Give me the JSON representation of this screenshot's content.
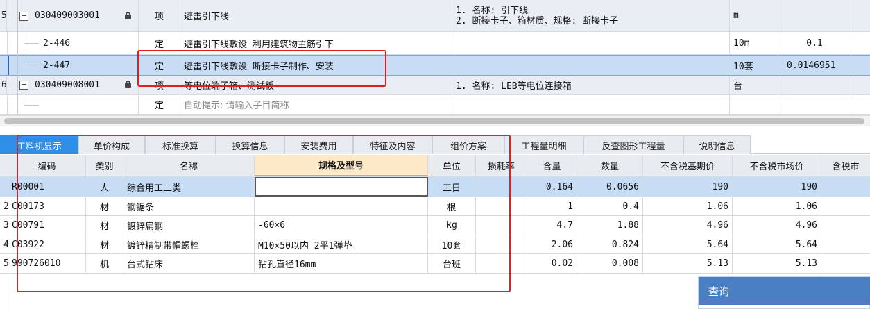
{
  "top_table": {
    "rows": [
      {
        "num": "5",
        "code": "030409003001",
        "lock": true,
        "type": "项",
        "name": "避雷引下线",
        "feature_lines": [
          "1. 名称: 引下线",
          "2. 断接卡子、箱材质、规格: 断接卡子"
        ],
        "unit": "m",
        "qty": "",
        "extra": ""
      },
      {
        "num": "",
        "code": "2-446",
        "lock": false,
        "type": "定",
        "name": "避雷引下线敷设 利用建筑物主筋引下",
        "feature_lines": [],
        "unit": "10m",
        "qty": "0.1",
        "extra": ""
      },
      {
        "num": "",
        "code": "2-447",
        "lock": false,
        "type": "定",
        "name": "避雷引下线敷设 断接卡子制作、安装",
        "feature_lines": [],
        "unit": "10套",
        "qty": "0.0146951",
        "extra": ""
      },
      {
        "num": "6",
        "code": "030409008001",
        "lock": true,
        "type": "项",
        "name": "等电位端子箱、测试板",
        "feature_lines": [
          "1. 名称: LEB等电位连接箱"
        ],
        "unit": "台",
        "qty": "",
        "extra": ""
      },
      {
        "num": "",
        "code": "",
        "lock": false,
        "type": "定",
        "name": "自动提示: 请输入子目简称",
        "feature_lines": [],
        "unit": "",
        "qty": "",
        "extra": ""
      }
    ]
  },
  "tabs": [
    "工料机显示",
    "单价构成",
    "标准换算",
    "换算信息",
    "安装费用",
    "特征及内容",
    "组价方案",
    "工程量明细",
    "反查图形工程量",
    "说明信息"
  ],
  "active_tab": "工料机显示",
  "bottom_table": {
    "headers": [
      "编码",
      "类别",
      "名称",
      "规格及型号",
      "单位",
      "损耗率",
      "含量",
      "数量",
      "不含税基期价",
      "不含税市场价",
      "含税市"
    ],
    "rows": [
      {
        "idx": "",
        "code": "R00001",
        "cat": "人",
        "name": "综合用工二类",
        "spec": "",
        "unit": "工日",
        "loss": "",
        "content": "0.164",
        "qty": "0.0656",
        "base": "190",
        "market": "190"
      },
      {
        "idx": "2",
        "code": "C00173",
        "cat": "材",
        "name": "钢锯条",
        "spec": "",
        "unit": "根",
        "loss": "",
        "content": "1",
        "qty": "0.4",
        "base": "1.06",
        "market": "1.06"
      },
      {
        "idx": "3",
        "code": "C00791",
        "cat": "材",
        "name": "镀锌扁钢",
        "spec": "-60×6",
        "unit": "kg",
        "loss": "",
        "content": "4.7",
        "qty": "1.88",
        "base": "4.96",
        "market": "4.96"
      },
      {
        "idx": "4",
        "code": "C03922",
        "cat": "材",
        "name": "镀锌精制带帽螺栓",
        "spec": "M10×50以内 2平1弹垫",
        "unit": "10套",
        "loss": "",
        "content": "2.06",
        "qty": "0.824",
        "base": "5.64",
        "market": "5.64"
      },
      {
        "idx": "5",
        "code": "990726010",
        "cat": "机",
        "name": "台式钻床",
        "spec": "钻孔直径16mm",
        "unit": "台班",
        "loss": "",
        "content": "0.02",
        "qty": "0.008",
        "base": "5.13",
        "market": "5.13"
      }
    ]
  },
  "query_panel": {
    "title": "查询"
  },
  "colors": {
    "selected_row": "#c7dcf5",
    "header_bg": "#e8ecf1",
    "active_tab": "#2f8fe6",
    "highlight_col": "#fde9c8",
    "annotation_red": "#e02020"
  }
}
